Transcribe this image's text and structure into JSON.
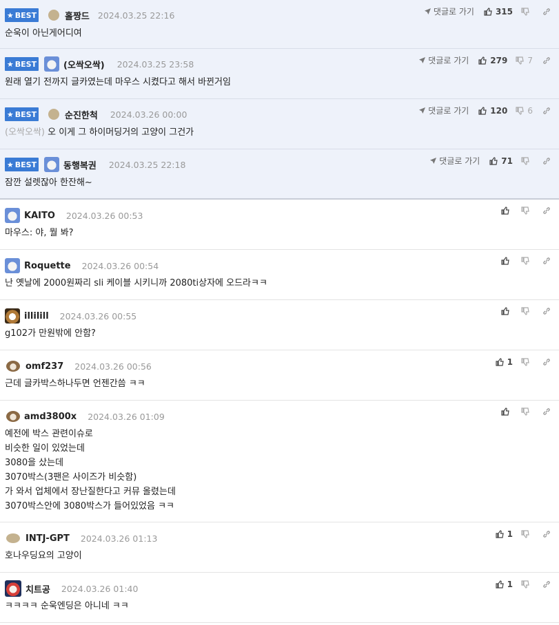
{
  "best_comments": [
    {
      "nick": "홀짱드",
      "date": "2024.03.25 22:16",
      "text": "순욱이 아닌게어디여",
      "reply_to": "",
      "up": "315",
      "down": "",
      "avatar": "dot"
    },
    {
      "nick": "(오싹오싹)",
      "date": "2024.03.25 23:58",
      "text": "원래 열기 전까지 글카였는데 마우스 시켰다고 해서 바뀐거임",
      "reply_to": "",
      "up": "279",
      "down": "7",
      "avatar": "dog"
    },
    {
      "nick": "순진한척",
      "date": "2024.03.26 00:00",
      "text": "오 이게 그 하이머딩거의 고양이 그건가",
      "reply_to": "(오싹오싹)",
      "up": "120",
      "down": "6",
      "avatar": "dot"
    },
    {
      "nick": "동행복권",
      "date": "2024.03.25 22:18",
      "text": "잠깐 설렛잖아 한잔해~",
      "reply_to": "",
      "up": "71",
      "down": "",
      "avatar": "dog"
    }
  ],
  "best_label": "BEST",
  "goto_label": "댓글로 가기",
  "comments": [
    {
      "nick": "KAITO",
      "date": "2024.03.26 00:53",
      "lines": [
        "마우스: 야, 뭘 봐?"
      ],
      "up": "",
      "avatar": "dog"
    },
    {
      "nick": "Roquette",
      "date": "2024.03.26 00:54",
      "lines": [
        "난 옛날에 2000원짜리 sli 케이블 시키니까 2080ti상자에 오드라ㅋㅋ"
      ],
      "up": "",
      "avatar": "dog"
    },
    {
      "nick": "illilill",
      "date": "2024.03.26 00:55",
      "lines": [
        "g102가 만원밖에 안함?"
      ],
      "up": "",
      "avatar": "cat"
    },
    {
      "nick": "omf237",
      "date": "2024.03.26 00:56",
      "lines": [
        "근데 글카박스하나두면 언젠간씀 ㅋㅋ"
      ],
      "up": "1",
      "avatar": "puppy"
    },
    {
      "nick": "amd3800x",
      "date": "2024.03.26 01:09",
      "lines": [
        "예전에 박스 관련이슈로",
        "비슷한 일이 있었는데",
        "3080을 샀는데",
        "3070박스(3팬은 사이즈가 비슷함)",
        "가 와서 업체에서 장난질한다고 커뮤 올렸는데",
        "3070박스안에 3080박스가 들어있었음 ㅋㅋ"
      ],
      "up": "",
      "avatar": "puppy"
    },
    {
      "nick": "INTJ-GPT",
      "date": "2024.03.26 01:13",
      "lines": [
        "호나우딩요의 고양이"
      ],
      "up": "1",
      "avatar": "dot"
    },
    {
      "nick": "치트공",
      "date": "2024.03.26 01:40",
      "lines": [
        "ㅋㅋㅋㅋ 순욱엔딩은 아니네 ㅋㅋ"
      ],
      "up": "1",
      "avatar": "lion"
    }
  ]
}
